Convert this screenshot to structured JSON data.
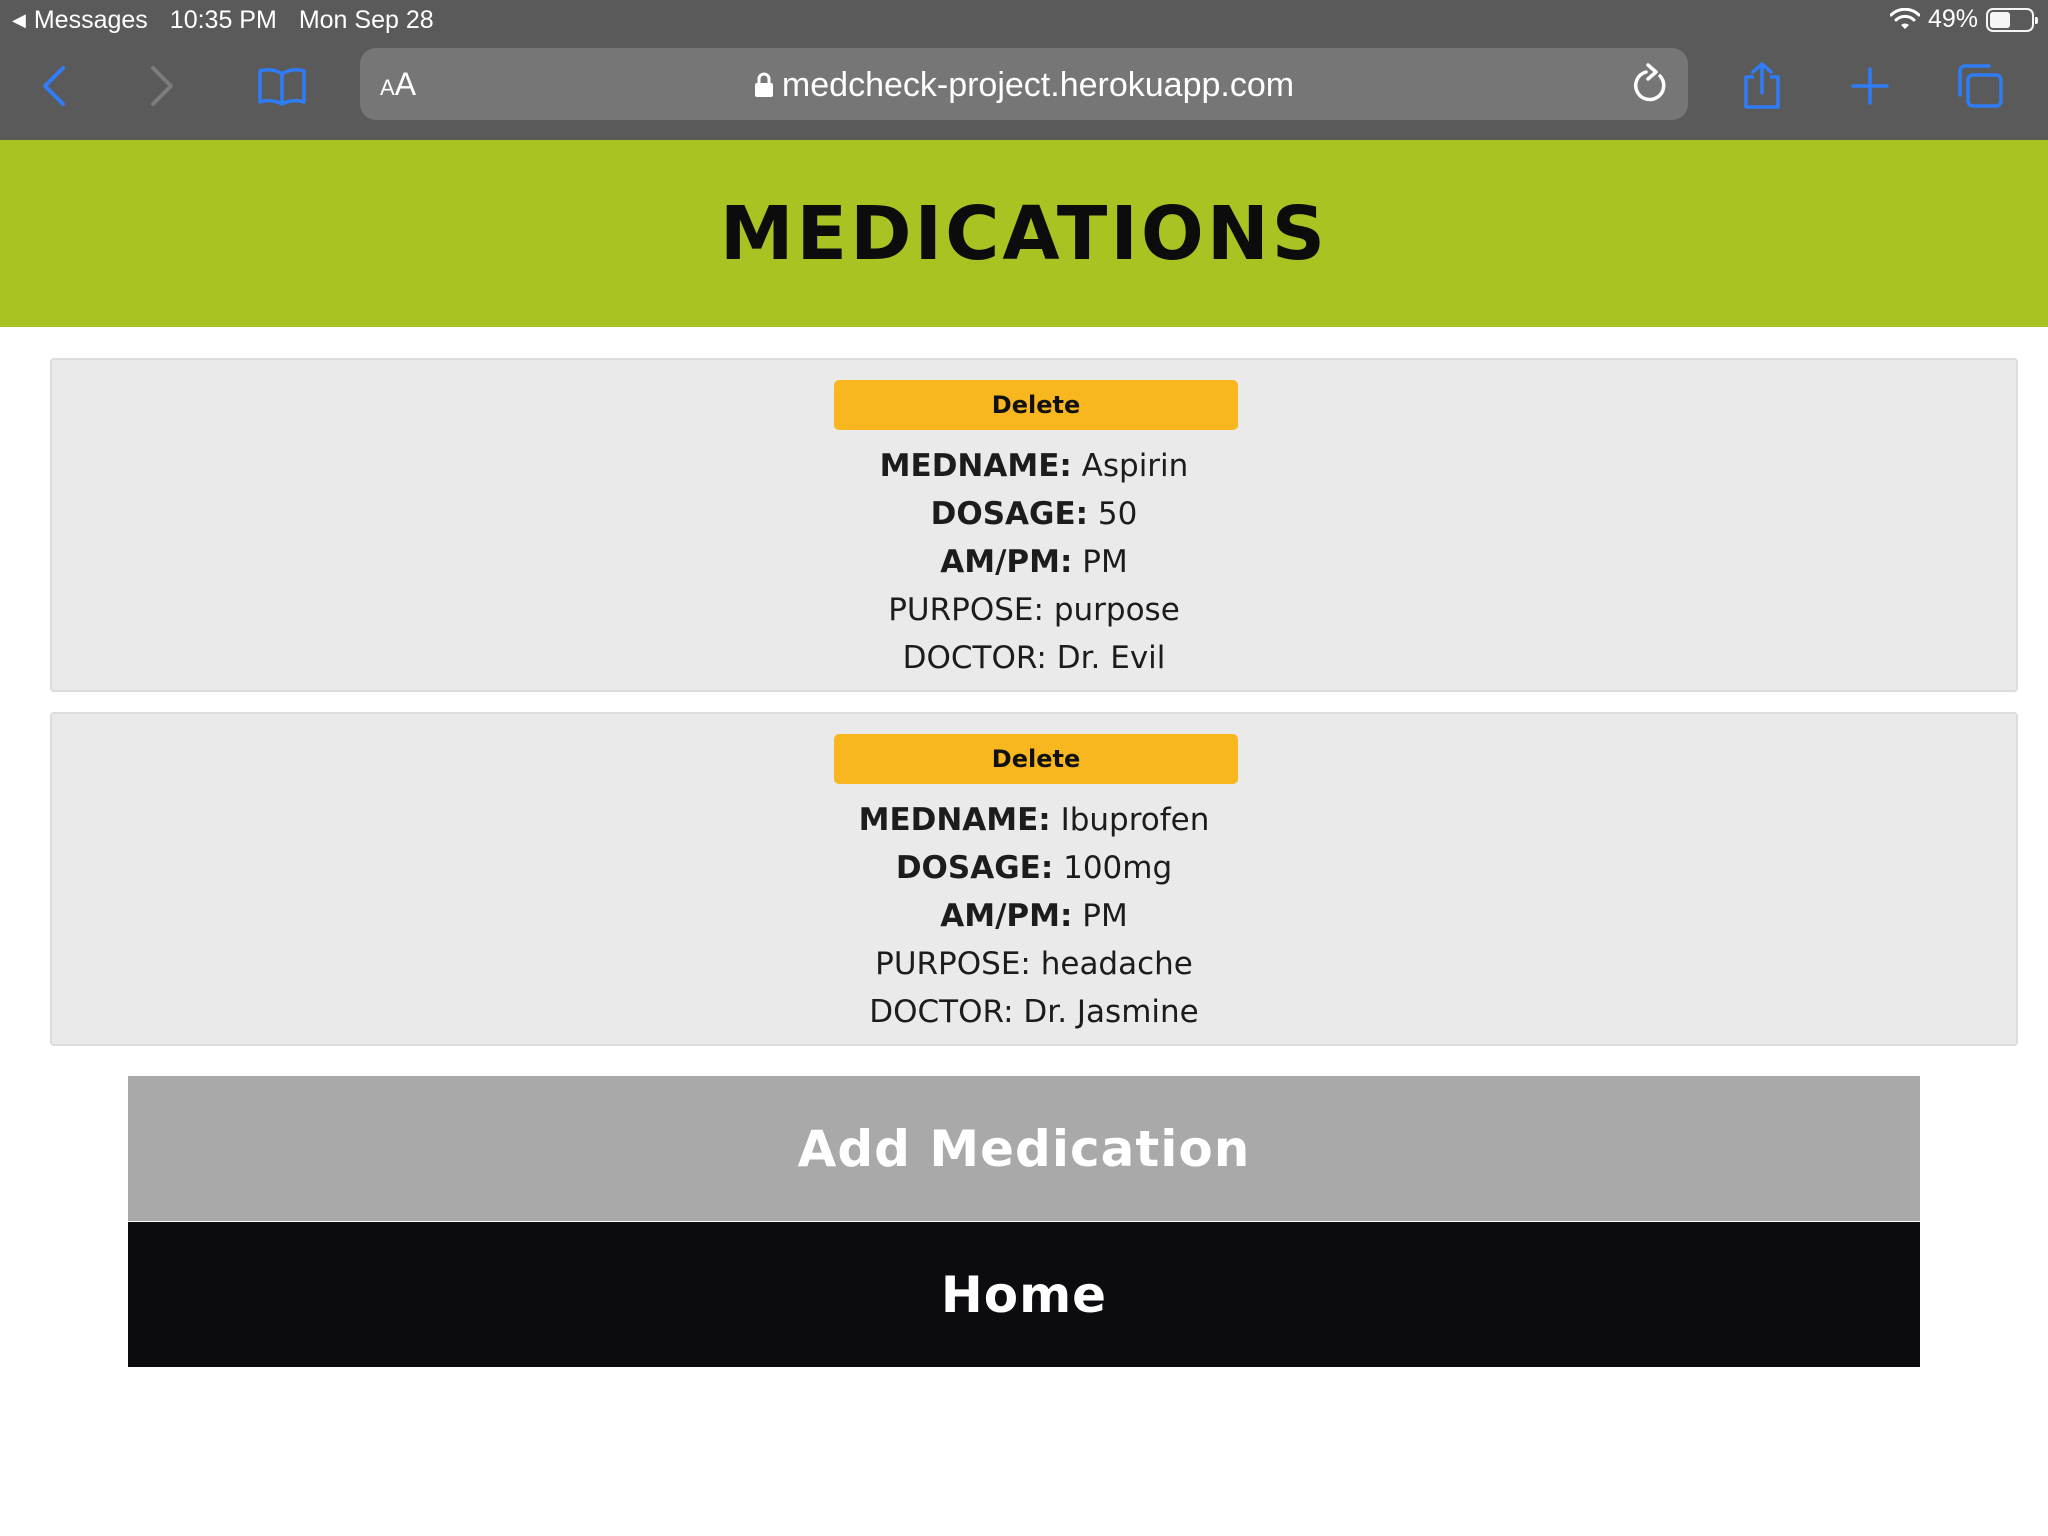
{
  "status_bar": {
    "back_app": "Messages",
    "time": "10:35 PM",
    "date": "Mon Sep 28",
    "battery": "49%",
    "battery_level": 0.49
  },
  "browser": {
    "text_size_label_small": "A",
    "text_size_label_large": "A",
    "url": "medcheck-project.herokuapp.com",
    "accent_color": "#2f7df6"
  },
  "page": {
    "title": "MEDICATIONS",
    "header_color": "#a9c422",
    "medications": [
      {
        "delete_label": "Delete",
        "medname_label": "MEDNAME:",
        "medname": "Aspirin",
        "dosage_label": "DOSAGE:",
        "dosage": "50",
        "ampm_label": "AM/PM:",
        "ampm": "PM",
        "purpose_label": "PURPOSE:",
        "purpose": "purpose",
        "doctor_label": "DOCTOR:",
        "doctor": "Dr. Evil"
      },
      {
        "delete_label": "Delete",
        "medname_label": "MEDNAME:",
        "medname": "Ibuprofen",
        "dosage_label": "DOSAGE:",
        "dosage": "100mg",
        "ampm_label": "AM/PM:",
        "ampm": "PM",
        "purpose_label": "PURPOSE:",
        "purpose": "headache",
        "doctor_label": "DOCTOR:",
        "doctor": "Dr. Jasmine"
      }
    ],
    "add_button": "Add Medication",
    "home_button": "Home"
  }
}
